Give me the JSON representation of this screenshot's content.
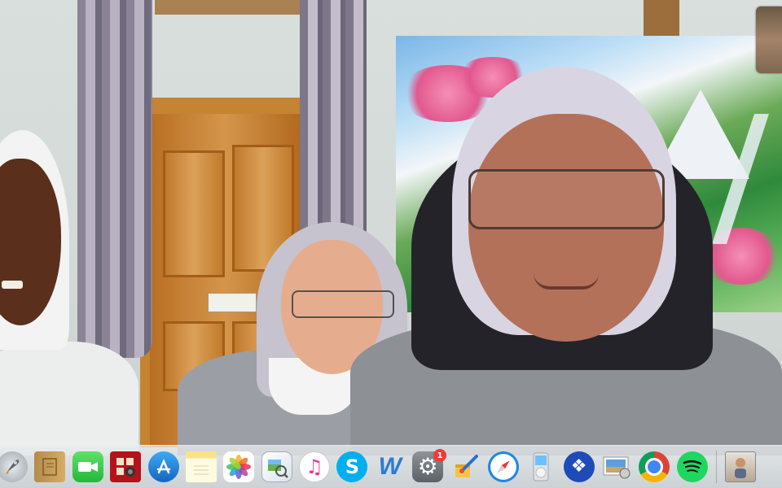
{
  "app": {
    "name": "Video call"
  },
  "dock": {
    "items": [
      {
        "id": "launchpad",
        "icon": "rocket-icon"
      },
      {
        "id": "notefile",
        "icon": "notebook-icon"
      },
      {
        "id": "facetime",
        "icon": "video-camera-icon"
      },
      {
        "id": "photo-booth",
        "icon": "photo-booth-icon"
      },
      {
        "id": "app-store",
        "icon": "app-store-icon"
      },
      {
        "id": "notes",
        "icon": "notes-icon"
      },
      {
        "id": "photos",
        "icon": "photos-flower-icon"
      },
      {
        "id": "preview",
        "icon": "preview-icon"
      },
      {
        "id": "itunes",
        "icon": "music-note-icon",
        "glyph": "♫"
      },
      {
        "id": "skype",
        "icon": "skype-icon",
        "glyph": "S"
      },
      {
        "id": "word",
        "icon": "word-icon",
        "glyph": "W"
      },
      {
        "id": "system-preferences",
        "icon": "gear-icon",
        "glyph": "⚙",
        "badge": "1"
      },
      {
        "id": "paintbrush",
        "icon": "paintbrush-icon"
      },
      {
        "id": "safari",
        "icon": "compass-icon"
      },
      {
        "id": "ipod",
        "icon": "ipod-icon"
      },
      {
        "id": "dropbox",
        "icon": "dropbox-icon",
        "glyph": "❖"
      },
      {
        "id": "image-capture",
        "icon": "image-capture-icon"
      },
      {
        "id": "chrome",
        "icon": "chrome-icon"
      },
      {
        "id": "spotify",
        "icon": "spotify-icon"
      }
    ],
    "trailing": {
      "id": "minimized-window",
      "icon": "thumbnail-icon"
    }
  },
  "colors": {
    "skype": "#00aff0",
    "word": "#2b7cd3",
    "safari": "#1e88e5",
    "dropbox": "#1e4bb8",
    "spotify": "#1ed760",
    "badge": "#f13b34"
  }
}
